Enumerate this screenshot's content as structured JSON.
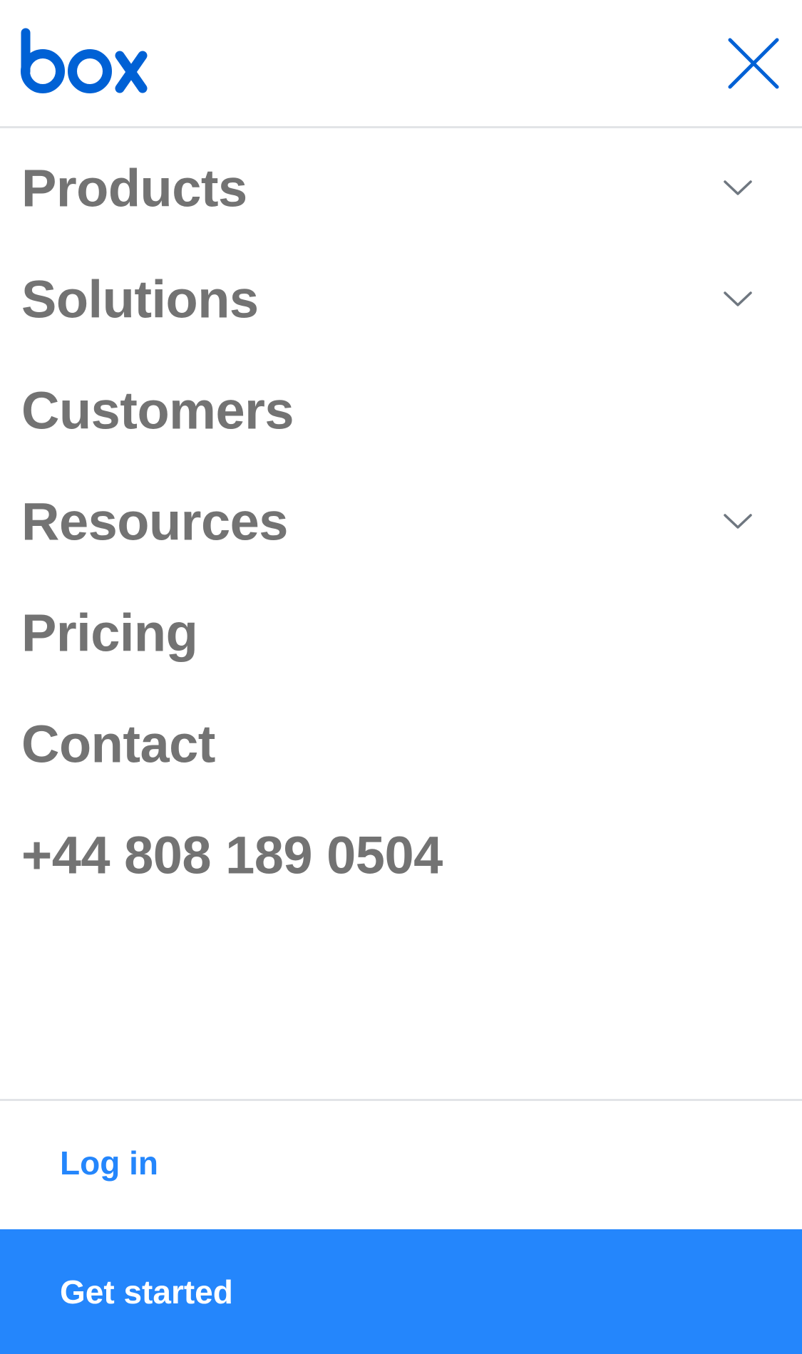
{
  "header": {
    "logo_text": "box",
    "close_icon": "close-icon",
    "brand_color": "#0061d5"
  },
  "nav": {
    "items": [
      {
        "label": "Products",
        "has_chevron": true,
        "icon": "chevron-down-icon"
      },
      {
        "label": "Solutions",
        "has_chevron": true,
        "icon": "chevron-down-icon"
      },
      {
        "label": "Customers",
        "has_chevron": false
      },
      {
        "label": "Resources",
        "has_chevron": true,
        "icon": "chevron-down-icon"
      },
      {
        "label": "Pricing",
        "has_chevron": false
      },
      {
        "label": "Contact",
        "has_chevron": false
      },
      {
        "label": "+44 808 189 0504",
        "has_chevron": false
      }
    ],
    "text_color": "#737373"
  },
  "footer": {
    "login_label": "Log in",
    "cta_label": "Get started",
    "accent_color": "#2486fc"
  }
}
